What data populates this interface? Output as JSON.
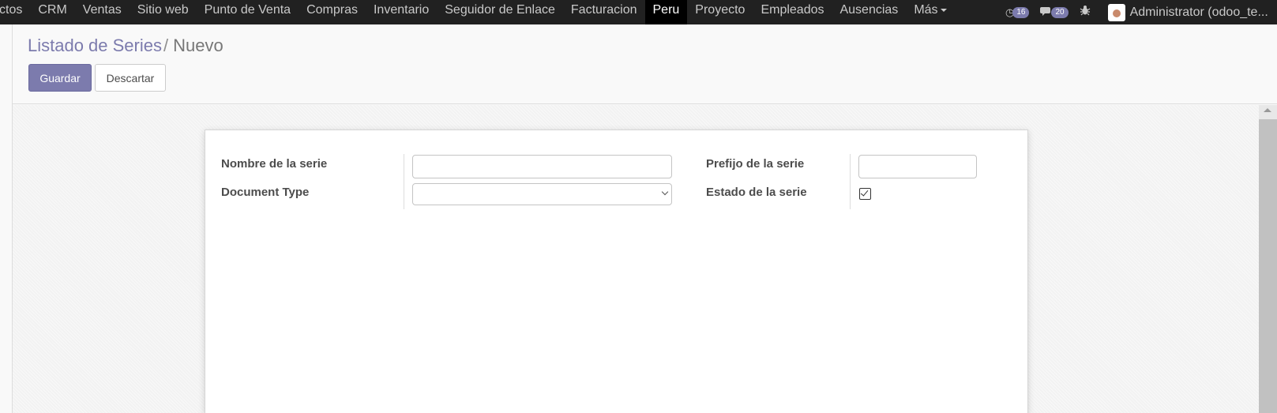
{
  "topbar": {
    "menu": [
      {
        "label": "ctos"
      },
      {
        "label": "CRM"
      },
      {
        "label": "Ventas"
      },
      {
        "label": "Sitio web"
      },
      {
        "label": "Punto de Venta"
      },
      {
        "label": "Compras"
      },
      {
        "label": "Inventario"
      },
      {
        "label": "Seguidor de Enlace"
      },
      {
        "label": "Facturacion"
      },
      {
        "label": "Peru",
        "active": true
      },
      {
        "label": "Proyecto"
      },
      {
        "label": "Empleados"
      },
      {
        "label": "Ausencias"
      },
      {
        "label": "Más"
      }
    ],
    "activities_count": "16",
    "messages_count": "20",
    "user_name": "Administrator (odoo_te..."
  },
  "breadcrumb": {
    "parent": "Listado de Series",
    "separator": "/",
    "current": "Nuevo"
  },
  "buttons": {
    "save": "Guardar",
    "discard": "Descartar"
  },
  "form": {
    "nombre_label": "Nombre de la serie",
    "nombre_value": "",
    "doc_type_label": "Document Type",
    "doc_type_value": "",
    "prefijo_label": "Prefijo de la serie",
    "prefijo_value": "",
    "estado_label": "Estado de la serie",
    "estado_checked": true
  },
  "colors": {
    "brand": "#7c7bad",
    "topbar": "#212121"
  }
}
